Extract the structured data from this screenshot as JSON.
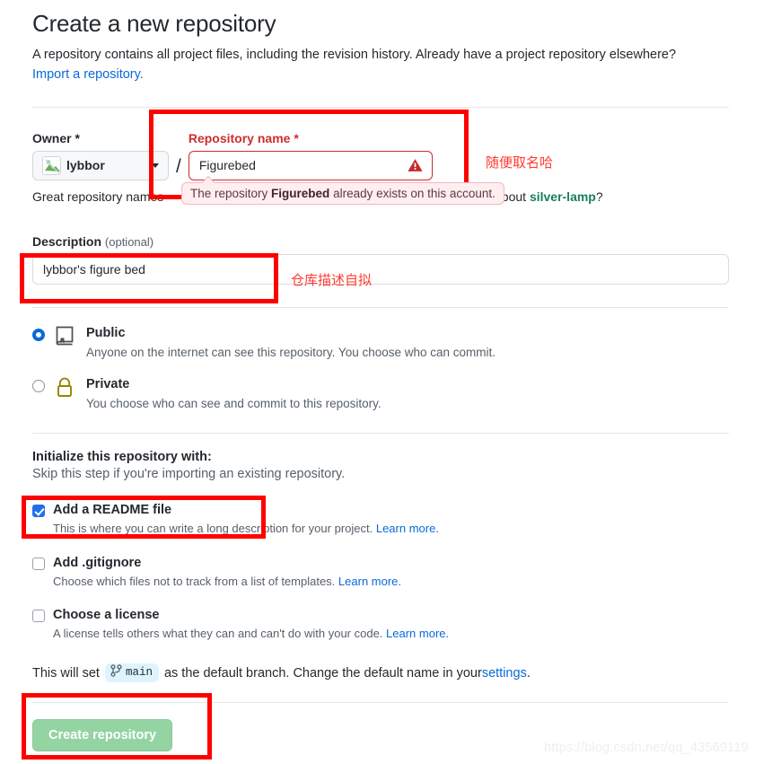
{
  "header": {
    "title": "Create a new repository",
    "subtitle": "A repository contains all project files, including the revision history. Already have a project repository elsewhere?",
    "import_link": "Import a repository."
  },
  "owner": {
    "label": "Owner",
    "required_mark": "*",
    "name": "lybbor",
    "avatar_icon": "broken-image-avatar"
  },
  "separator": "/",
  "repo_name": {
    "label": "Repository name",
    "required_mark": "*",
    "value": "Figurebed",
    "error_icon": "alert-triangle-icon",
    "tooltip_prefix": "The repository ",
    "tooltip_name": "Figurebed",
    "tooltip_suffix": " already exists on this account."
  },
  "hint": {
    "before": "Great repository names",
    "after": "about ",
    "suggestion": "silver-lamp",
    "question": "?"
  },
  "description": {
    "label": "Description",
    "optional": "(optional)",
    "value": "lybbor's figure bed",
    "placeholder": ""
  },
  "visibility": [
    {
      "id": "public",
      "name": "Public",
      "desc": "Anyone on the internet can see this repository. You choose who can commit.",
      "icon": "book-icon",
      "selected": true
    },
    {
      "id": "private",
      "name": "Private",
      "desc": "You choose who can see and commit to this repository.",
      "icon": "lock-icon",
      "selected": false
    }
  ],
  "initialize": {
    "title": "Initialize this repository with:",
    "subtitle": "Skip this step if you're importing an existing repository.",
    "options": [
      {
        "id": "readme",
        "name": "Add a README file",
        "desc": "This is where you can write a long description for your project. ",
        "learn_more": "Learn more.",
        "checked": true
      },
      {
        "id": "gitignore",
        "name": "Add .gitignore",
        "desc": "Choose which files not to track from a list of templates. ",
        "learn_more": "Learn more.",
        "checked": false
      },
      {
        "id": "license",
        "name": "Choose a license",
        "desc": "A license tells others what they can and can't do with your code. ",
        "learn_more": "Learn more.",
        "checked": false
      }
    ]
  },
  "branch": {
    "prefix": "This will set",
    "badge_icon": "git-branch-icon",
    "badge": "main",
    "middle": "as the default branch. Change the default name in your ",
    "settings_link": "settings",
    "period": "."
  },
  "submit": {
    "label": "Create repository",
    "disabled": true,
    "color": "#94d3a2"
  },
  "annotations": {
    "repo_name_note": "随便取名哈",
    "description_note": "仓库描述自拟",
    "box_color": "#ff0000"
  },
  "watermark": "https://blog.csdn.net/qq_43569119"
}
